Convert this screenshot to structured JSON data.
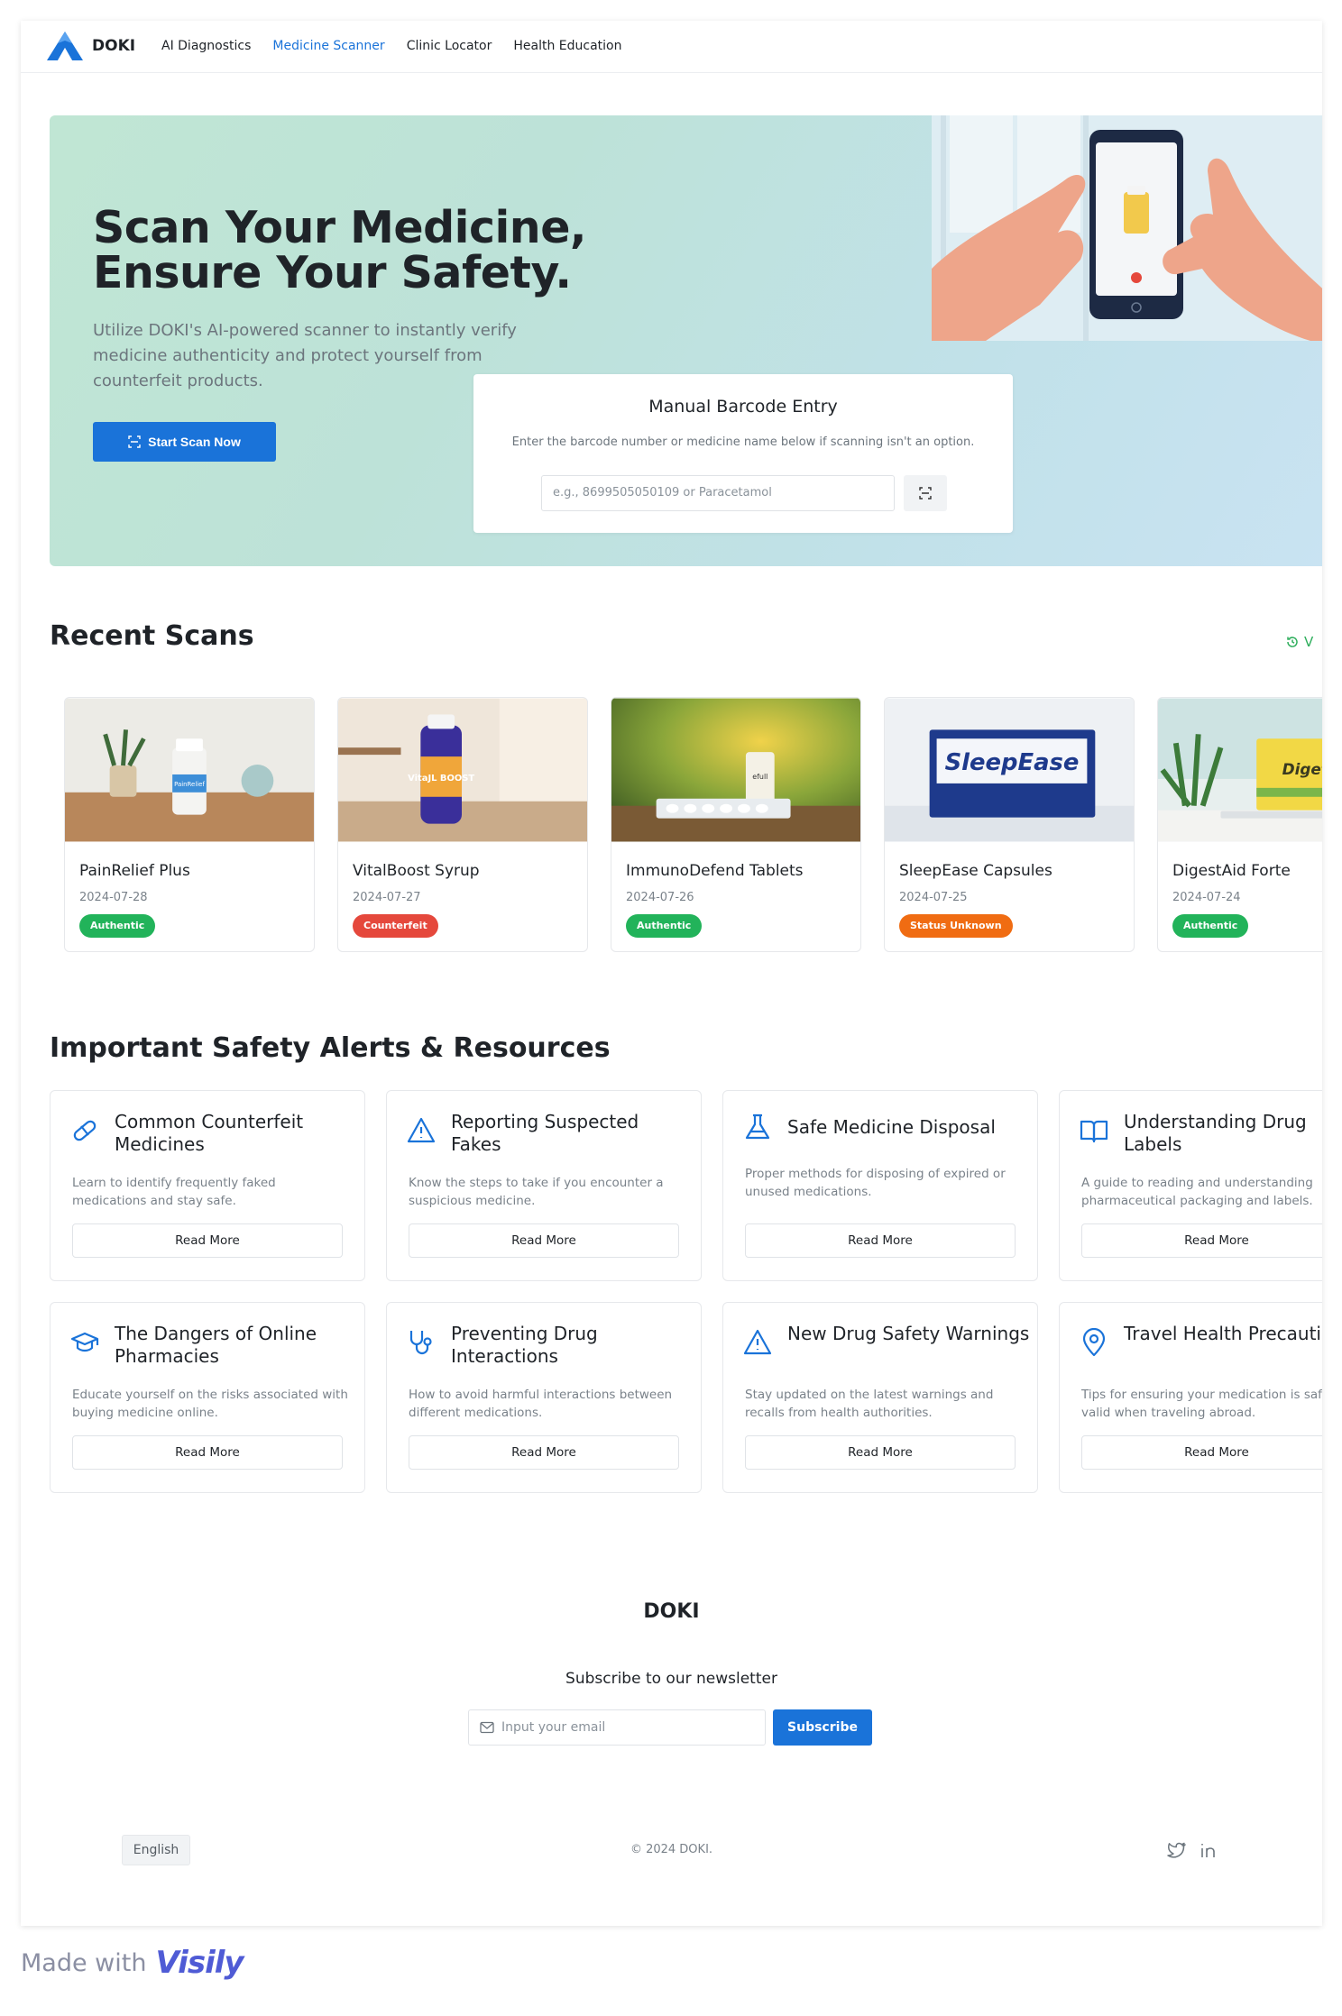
{
  "app": {
    "logo_text": "DOKI",
    "nav": [
      "AI Diagnostics",
      "Medicine Scanner",
      "Clinic Locator",
      "Health Education"
    ],
    "active_nav_index": 1
  },
  "hero": {
    "title_line1": "Scan Your Medicine,",
    "title_line2": "Ensure Your Safety.",
    "description": "Utilize DOKI's AI-powered scanner to instantly verify medicine authenticity and protect yourself from counterfeit products.",
    "cta_label": "Start Scan Now",
    "manual": {
      "title": "Manual Barcode Entry",
      "subtitle": "Enter the barcode number or medicine name below if scanning isn't an option.",
      "placeholder": "e.g., 8699505050109 or Paracetamol"
    }
  },
  "recent_scans": {
    "title": "Recent Scans",
    "view_all_label": "V",
    "items": [
      {
        "name": "PainRelief Plus",
        "date": "2024-07-28",
        "status": "Authentic",
        "status_color": "#22b35a"
      },
      {
        "name": "VitalBoost Syrup",
        "date": "2024-07-27",
        "status": "Counterfeit",
        "status_color": "#e5483c"
      },
      {
        "name": "ImmunoDefend Tablets",
        "date": "2024-07-26",
        "status": "Authentic",
        "status_color": "#22b35a"
      },
      {
        "name": "SleepEase Capsules",
        "date": "2024-07-25",
        "status": "Status Unknown",
        "status_color": "#f06c12"
      },
      {
        "name": "DigestAid Forte",
        "date": "2024-07-24",
        "status": "Authentic",
        "status_color": "#22b35a"
      }
    ],
    "product_labels": [
      "PainRelief",
      "VitaJL BOOST",
      "efull",
      "SleepEase",
      "DigetAid"
    ]
  },
  "alerts": {
    "title": "Important Safety Alerts & Resources",
    "read_more_label": "Read More",
    "items": [
      {
        "title": "Common Counterfeit Medicines",
        "description": "Learn to identify frequently faked medications and stay safe.",
        "icon": "pill-icon"
      },
      {
        "title": "Reporting Suspected Fakes",
        "description": "Know the steps to take if you encounter a suspicious medicine.",
        "icon": "warning-triangle-icon"
      },
      {
        "title": "Safe Medicine Disposal",
        "description": "Proper methods for disposing of expired or unused medications.",
        "icon": "flask-icon"
      },
      {
        "title": "Understanding Drug Labels",
        "description": "A guide to reading and understanding pharmaceutical packaging and labels.",
        "icon": "open-book-icon"
      },
      {
        "title": "The Dangers of Online Pharmacies",
        "description": "Educate yourself on the risks associated with buying medicine online.",
        "icon": "graduation-cap-icon"
      },
      {
        "title": "Preventing Drug Interactions",
        "description": "How to avoid harmful interactions between different medications.",
        "icon": "stethoscope-icon"
      },
      {
        "title": "New Drug Safety Warnings",
        "description": "Stay updated on the latest warnings and recalls from health authorities.",
        "icon": "warning-triangle-icon"
      },
      {
        "title": "Travel Health Precautions",
        "description": "Tips for ensuring your medication is safe and valid when traveling abroad.",
        "icon": "location-pin-icon"
      }
    ]
  },
  "footer": {
    "logo_text": "DOKI",
    "newsletter_title": "Subscribe to our newsletter",
    "email_placeholder": "Input your email",
    "subscribe_label": "Subscribe",
    "language": "English",
    "copyright": "© 2024 DOKI."
  },
  "watermark": {
    "made_with": "Made with",
    "brand": "Visily"
  },
  "colors": {
    "primary": "#1a73d9",
    "authentic": "#22b35a",
    "counterfeit": "#e5483c",
    "unknown": "#f06c12"
  }
}
